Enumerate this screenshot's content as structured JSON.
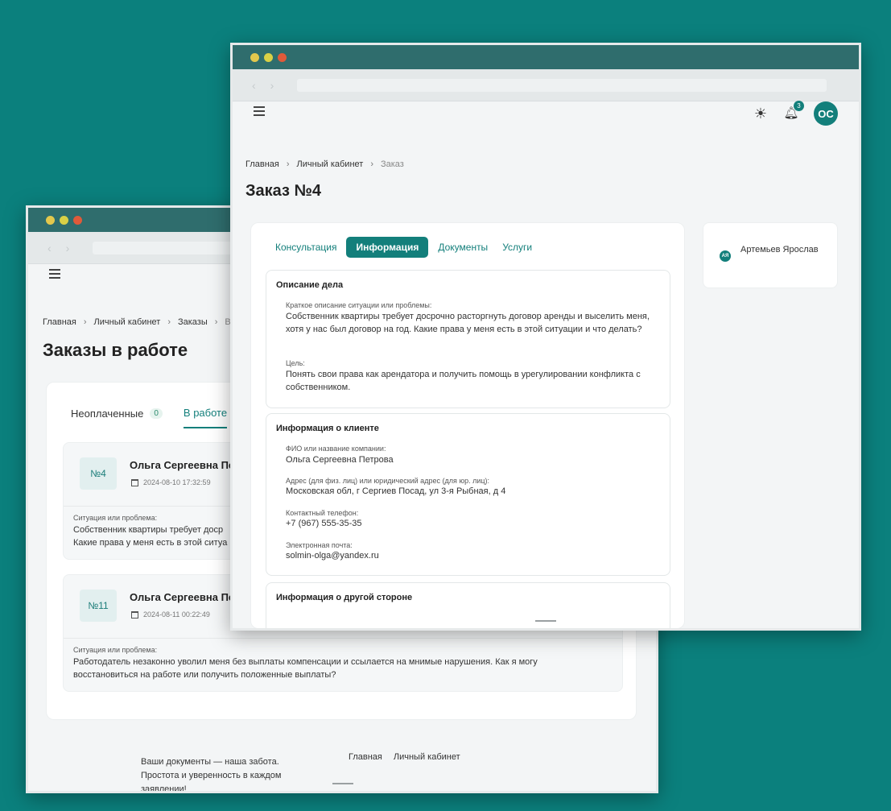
{
  "back_window": {
    "breadcrumb": [
      "Главная",
      "Личный кабинет",
      "Заказы",
      "В"
    ],
    "title": "Заказы в работе",
    "tabs": [
      {
        "label": "Неоплаченные",
        "badge": "0"
      },
      {
        "label": "В работе"
      }
    ],
    "orders": [
      {
        "number": "№4",
        "name": "Ольга Сергеевна Пет",
        "date": "2024-08-10 17:32:59",
        "label": "Ситуация или проблема:",
        "text_line1": "Собственник квартиры требует доср",
        "text_line2": "Какие права у меня есть в этой ситуа"
      },
      {
        "number": "№11",
        "name": "Ольга Сергеевна Пет",
        "date": "2024-08-11 00:22:49",
        "label": "Ситуация или проблема:",
        "text_line1": "Работодатель незаконно уволил меня без выплаты компенсации и ссылается на мнимые нарушения. Как я могу",
        "text_line2": "восстановиться на работе или получить положенные выплаты?"
      }
    ],
    "footer": {
      "text": "Ваши документы — наша забота. Простота и уверенность в каждом заявлении!",
      "links": [
        "Главная",
        "Личный кабинет"
      ]
    }
  },
  "front_window": {
    "notifications_count": "3",
    "avatar_initials": "ОС",
    "breadcrumb": [
      "Главная",
      "Личный кабинет",
      "Заказ"
    ],
    "title": "Заказ №4",
    "tabs": [
      {
        "label": "Консультация"
      },
      {
        "label": "Информация",
        "active": true
      },
      {
        "label": "Документы"
      },
      {
        "label": "Услуги"
      }
    ],
    "case_description": {
      "title": "Описание дела",
      "short_label": "Краткое описание ситуации или проблемы:",
      "short_value": "Собственник квартиры требует досрочно расторгнуть договор аренды и выселить меня, хотя у нас был договор на год. Какие права у меня есть в этой ситуации и что делать?",
      "goal_label": "Цель:",
      "goal_value": "Понять свои права как арендатора и получить помощь в урегулировании конфликта с собственником."
    },
    "client_info": {
      "title": "Информация о клиенте",
      "name_label": "ФИО или название компании:",
      "name_value": "Ольга Сергеевна Петрова",
      "address_label": "Адрес (для физ. лиц) или юридический адрес (для юр. лиц):",
      "address_value": "Московская обл, г Сергиев Посад, ул 3-я Рыбная, д 4",
      "phone_label": "Контактный телефон:",
      "phone_value": "+7 (967) 555-35-35",
      "email_label": "Электронная почта:",
      "email_value": "solmin-olga@yandex.ru"
    },
    "other_party": {
      "title": "Информация о другой стороне"
    },
    "lawyer": {
      "initials": "АЯ",
      "name": "Артемьев Ярослав"
    }
  },
  "colors": {
    "background": "#0b807d",
    "accent": "#137f7b"
  }
}
